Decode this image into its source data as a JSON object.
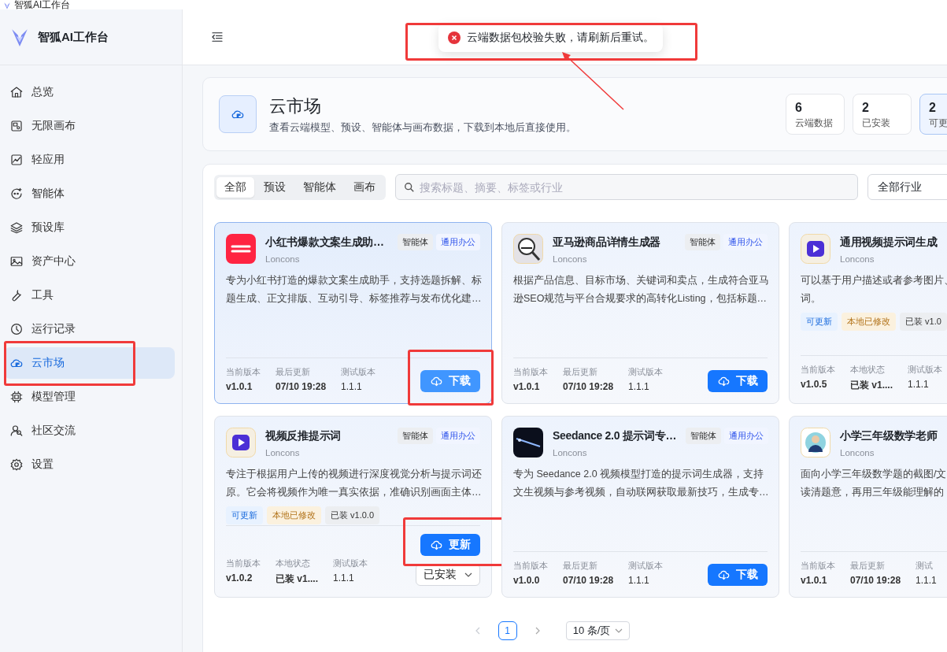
{
  "window": {
    "title": "智狐AI工作台"
  },
  "sidebar": {
    "app_name": "智狐AI工作台",
    "items": [
      {
        "label": "总览",
        "selected": false,
        "annotated": false
      },
      {
        "label": "无限画布",
        "selected": false,
        "annotated": false
      },
      {
        "label": "轻应用",
        "selected": false,
        "annotated": false
      },
      {
        "label": "智能体",
        "selected": false,
        "annotated": false
      },
      {
        "label": "预设库",
        "selected": false,
        "annotated": false
      },
      {
        "label": "资产中心",
        "selected": false,
        "annotated": false
      },
      {
        "label": "工具",
        "selected": false,
        "annotated": false
      },
      {
        "label": "运行记录",
        "selected": false,
        "annotated": false
      },
      {
        "label": "云市场",
        "selected": true,
        "annotated": true
      },
      {
        "label": "模型管理",
        "selected": false,
        "annotated": false
      },
      {
        "label": "社区交流",
        "selected": false,
        "annotated": false
      },
      {
        "label": "设置",
        "selected": false,
        "annotated": false
      }
    ]
  },
  "toast": {
    "kind": "error",
    "message": "云端数据包校验失败，请刷新后重试。",
    "annotated": true,
    "arrow": true
  },
  "hero": {
    "title": "云市场",
    "subtitle": "查看云端模型、预设、智能体与画布数据，下载到本地后直接使用。",
    "stats": [
      {
        "value": "6",
        "label": "云端数据",
        "selected": false
      },
      {
        "value": "2",
        "label": "已安装",
        "selected": false
      },
      {
        "value": "2",
        "label": "可更",
        "selected": true
      }
    ]
  },
  "filters": {
    "tabs": [
      {
        "label": "全部",
        "selected": true
      },
      {
        "label": "预设",
        "selected": false
      },
      {
        "label": "智能体",
        "selected": false
      },
      {
        "label": "画布",
        "selected": false
      }
    ],
    "search": {
      "placeholder": "搜索标题、摘要、标签或行业"
    },
    "industry": {
      "value": "全部行业"
    }
  },
  "cards": [
    {
      "title": "小红书爆款文案生成助…",
      "author": "Loncons",
      "selected": true,
      "tags": [
        {
          "label": "智能体",
          "kind": "type"
        },
        {
          "label": "通用办公",
          "kind": "industry"
        }
      ],
      "description_lines": [
        "专为小红书打造的爆款文案生成助手，支持选题拆解、标",
        "题生成、正文排版、互动引导、标签推荐与发布优化建…"
      ],
      "meta": [
        {
          "label": "当前版本",
          "value": "v1.0.1"
        },
        {
          "label": "最后更新",
          "value": "07/10 19:28"
        },
        {
          "label": "测试版本",
          "value": "1.1.1"
        }
      ],
      "actions": [
        {
          "label": "下载",
          "kind": "primary",
          "annotated": true
        }
      ]
    },
    {
      "title": "亚马逊商品详情生成器",
      "author": "Loncons",
      "selected": false,
      "tags": [
        {
          "label": "智能体",
          "kind": "type"
        },
        {
          "label": "通用办公",
          "kind": "industry"
        }
      ],
      "description_lines": [
        "根据产品信息、目标市场、关键词和卖点，生成符合亚马",
        "逊SEO规范与平台合规要求的高转化Listing，包括标题…"
      ],
      "meta": [
        {
          "label": "当前版本",
          "value": "v1.0.1"
        },
        {
          "label": "最后更新",
          "value": "07/10 19:28"
        },
        {
          "label": "测试版本",
          "value": "1.1.1"
        }
      ],
      "actions": [
        {
          "label": "下载",
          "kind": "primary",
          "annotated": false
        }
      ]
    },
    {
      "title": "通用视频提示词生成",
      "author": "Loncons",
      "selected": false,
      "description_lines": [
        "可以基于用户描述或者参考图片、",
        "词。"
      ],
      "status_tags": [
        {
          "label": "可更新",
          "kind": "update"
        },
        {
          "label": "本地已修改",
          "kind": "modified"
        },
        {
          "label": "已装 v1.0",
          "kind": "installed"
        }
      ],
      "meta": [
        {
          "label": "当前版本",
          "value": "v1.0.5"
        },
        {
          "label": "本地状态",
          "value": "已装 v1...."
        },
        {
          "label": "测试版本",
          "value": "1.1.1"
        }
      ]
    },
    {
      "title": "视频反推提示词",
      "author": "Loncons",
      "selected": false,
      "tags": [
        {
          "label": "智能体",
          "kind": "type"
        },
        {
          "label": "通用办公",
          "kind": "industry"
        }
      ],
      "description_lines": [
        "专注于根据用户上传的视频进行深度视觉分析与提示词还",
        "原。它会将视频作为唯一真实依据，准确识别画面主体…"
      ],
      "status_tags": [
        {
          "label": "可更新",
          "kind": "update"
        },
        {
          "label": "本地已修改",
          "kind": "modified"
        },
        {
          "label": "已装 v1.0.0",
          "kind": "installed"
        }
      ],
      "meta": [
        {
          "label": "当前版本",
          "value": "v1.0.2"
        },
        {
          "label": "本地状态",
          "value": "已装 v1...."
        },
        {
          "label": "测试版本",
          "value": "1.1.1"
        }
      ],
      "actions": [
        {
          "label": "更新",
          "kind": "primary",
          "annotated": true
        },
        {
          "label": "已安装",
          "kind": "select",
          "annotated": false
        }
      ]
    },
    {
      "title": "Seedance 2.0 提示词专…",
      "author": "Loncons",
      "selected": false,
      "tags": [
        {
          "label": "智能体",
          "kind": "type"
        },
        {
          "label": "通用办公",
          "kind": "industry"
        }
      ],
      "description_lines": [
        "专为 Seedance 2.0 视频模型打造的提示词生成器，支持",
        "文生视频与参考视频，自动联网获取最新技巧，生成专…"
      ],
      "meta": [
        {
          "label": "当前版本",
          "value": "v1.0.0"
        },
        {
          "label": "最后更新",
          "value": "07/10 19:28"
        },
        {
          "label": "测试版本",
          "value": "1.1.1"
        }
      ],
      "actions": [
        {
          "label": "下载",
          "kind": "primary",
          "annotated": false
        }
      ]
    },
    {
      "title": "小学三年级数学老师",
      "author": "Loncons",
      "selected": false,
      "description_lines": [
        "面向小学三年级数学题的截图/文",
        "读清题意，再用三年级能理解的"
      ],
      "meta": [
        {
          "label": "当前版本",
          "value": "v1.0.1"
        },
        {
          "label": "最后更新",
          "value": "07/10 19:28"
        },
        {
          "label": "测试",
          "value": "1.1.1"
        }
      ]
    }
  ],
  "pagination": {
    "pages": [
      {
        "label": "1",
        "selected": true
      }
    ],
    "prev_disabled": true,
    "page_size": "10 条/页"
  }
}
